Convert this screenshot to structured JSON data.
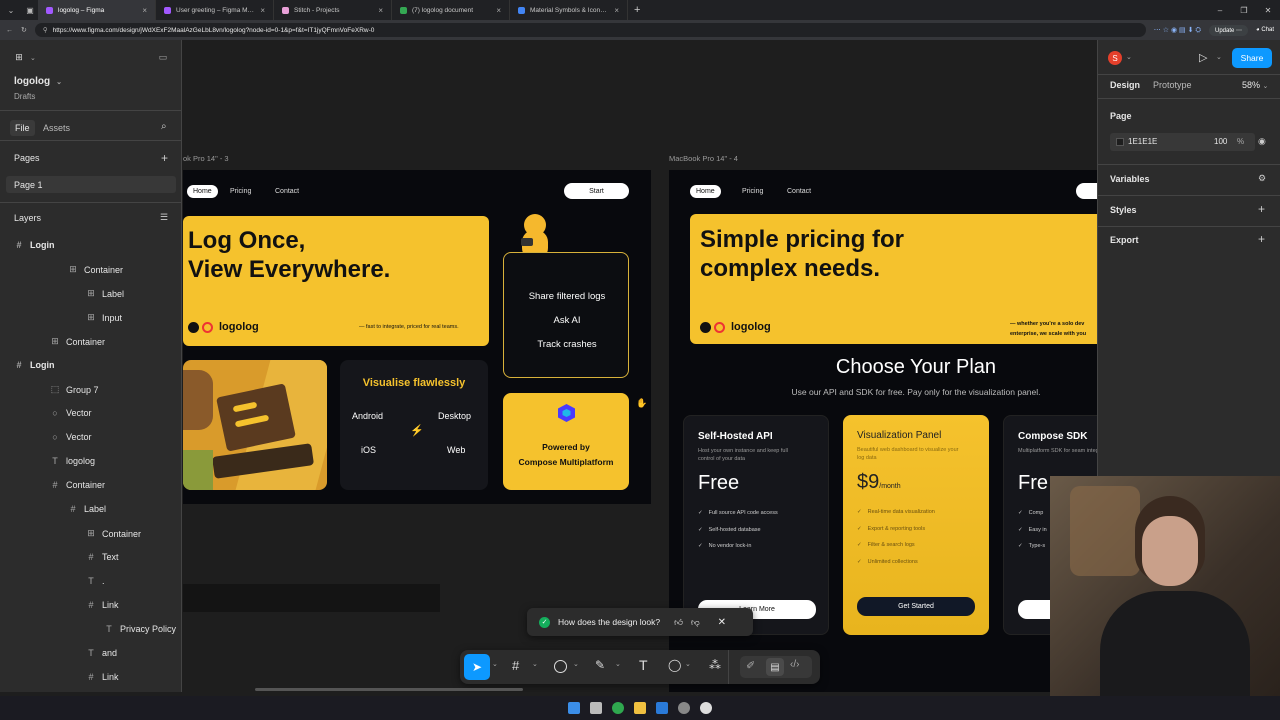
{
  "browser": {
    "tabs": [
      {
        "title": "logolog – Figma",
        "color": "#a259ff",
        "active": true
      },
      {
        "title": "User greeting – Figma Make",
        "color": "#a259ff",
        "active": false
      },
      {
        "title": "Stitch - Projects",
        "color": "#e8a0d8",
        "active": false
      },
      {
        "title": "(7) logolog document",
        "color": "#34a853",
        "active": false
      },
      {
        "title": "Material Symbols & Icons - Google",
        "color": "#4285f4",
        "active": false
      }
    ],
    "url": "https://www.figma.com/design/jWdXExF2MaalAzGeLbL8vn/logolog?node-id=0-1&p=f&t=IT1jyQFmnVoFeXRw-0",
    "update_label": "Update",
    "chat_label": "Chat"
  },
  "left_panel": {
    "file_name": "logolog",
    "drafts": "Drafts",
    "tab_file": "File",
    "tab_assets": "Assets",
    "pages_heading": "Pages",
    "page1": "Page 1",
    "layers_heading": "Layers",
    "layers": [
      {
        "name": "Login",
        "icon": "frame-icon",
        "depth": 0
      },
      {
        "name": "Container",
        "icon": "grid-icon",
        "depth": 3
      },
      {
        "name": "Label",
        "icon": "grid-icon",
        "depth": 4
      },
      {
        "name": "Input",
        "icon": "grid-icon",
        "depth": 4
      },
      {
        "name": "Container",
        "icon": "grid-icon",
        "depth": 2
      },
      {
        "name": "Login",
        "icon": "frame-icon",
        "depth": 0
      },
      {
        "name": "Group 7",
        "icon": "group-icon",
        "depth": 2
      },
      {
        "name": "Vector",
        "icon": "vector-icon",
        "depth": 2
      },
      {
        "name": "Vector",
        "icon": "vector-icon",
        "depth": 2
      },
      {
        "name": "logolog",
        "icon": "text-icon",
        "depth": 2
      },
      {
        "name": "Container",
        "icon": "frame-icon",
        "depth": 2
      },
      {
        "name": "Label",
        "icon": "frame-icon",
        "depth": 3
      },
      {
        "name": "Container",
        "icon": "grid-icon",
        "depth": 4
      },
      {
        "name": "Text",
        "icon": "frame-icon",
        "depth": 4
      },
      {
        "name": ".",
        "icon": "text-icon",
        "depth": 4
      },
      {
        "name": "Link",
        "icon": "frame-icon",
        "depth": 4
      },
      {
        "name": "Privacy Policy",
        "icon": "text-icon",
        "depth": 5
      },
      {
        "name": "and",
        "icon": "text-icon",
        "depth": 4
      },
      {
        "name": "Link",
        "icon": "frame-icon",
        "depth": 4
      },
      {
        "name": "Terms of Servic",
        "icon": "text-icon",
        "depth": 5
      }
    ]
  },
  "right_panel": {
    "avatar": "S",
    "share": "Share",
    "tab_design": "Design",
    "tab_prototype": "Prototype",
    "zoom": "58%",
    "page_heading": "Page",
    "page_color": "1E1E1E",
    "page_opacity": "100",
    "percent": "%",
    "variables": "Variables",
    "styles": "Styles",
    "export": "Export"
  },
  "frame1": {
    "label": "ok Pro 14\" - 3",
    "nav": [
      "Home",
      "Pricing",
      "Contact"
    ],
    "start": "Start",
    "hero_line1": "Log Once,",
    "hero_line2": "View Everywhere.",
    "brand": "logolog",
    "tagline": "— fast to integrate, priced for real teams.",
    "features": [
      "Share filtered logs",
      "Ask AI",
      "Track crashes"
    ],
    "visualise_title": "Visualise flawlessly",
    "platforms": [
      "Android",
      "Desktop",
      "iOS",
      "Web"
    ],
    "powered_line1": "Powered by",
    "powered_line2": "Compose Multiplatform"
  },
  "frame2": {
    "label": "MacBook Pro 14\" - 4",
    "nav": [
      "Home",
      "Pricing",
      "Contact"
    ],
    "hero_line1": "Simple pricing for",
    "hero_line2": "complex needs.",
    "brand": "logolog",
    "tagline1": "— whether you're a solo dev",
    "tagline2": "enterprise, we scale with you",
    "plan_title": "Choose Your Plan",
    "plan_sub": "Use our API and SDK for free. Pay only for the visualization panel.",
    "plans": [
      {
        "name": "Self-Hosted API",
        "desc": "Host your own instance and keep full control of your data",
        "price": "Free",
        "period": "",
        "features": [
          "Full source API code access",
          "Self-hosted database",
          "No vendor lock-in"
        ],
        "cta": "Learn More"
      },
      {
        "name": "Visualization Panel",
        "desc": "Beautiful web dashboard to visualize your log data",
        "price": "$9",
        "period": "/month",
        "features": [
          "Real-time data visualization",
          "Export & reporting tools",
          "Filter & search logs",
          "Unlimited collections"
        ],
        "cta": "Get Started"
      },
      {
        "name": "Compose SDK",
        "desc": "Multiplatform SDK for seam integration",
        "price": "Fre",
        "period": "",
        "features": [
          "Comp",
          "Easy in",
          "Type-s"
        ],
        "cta": ""
      }
    ]
  },
  "feedback": {
    "question": "How does the design look?"
  },
  "colors": {
    "accent_blue": "#0d99ff",
    "brand_yellow": "#f5c22d",
    "frame_bg": "#08090d"
  }
}
